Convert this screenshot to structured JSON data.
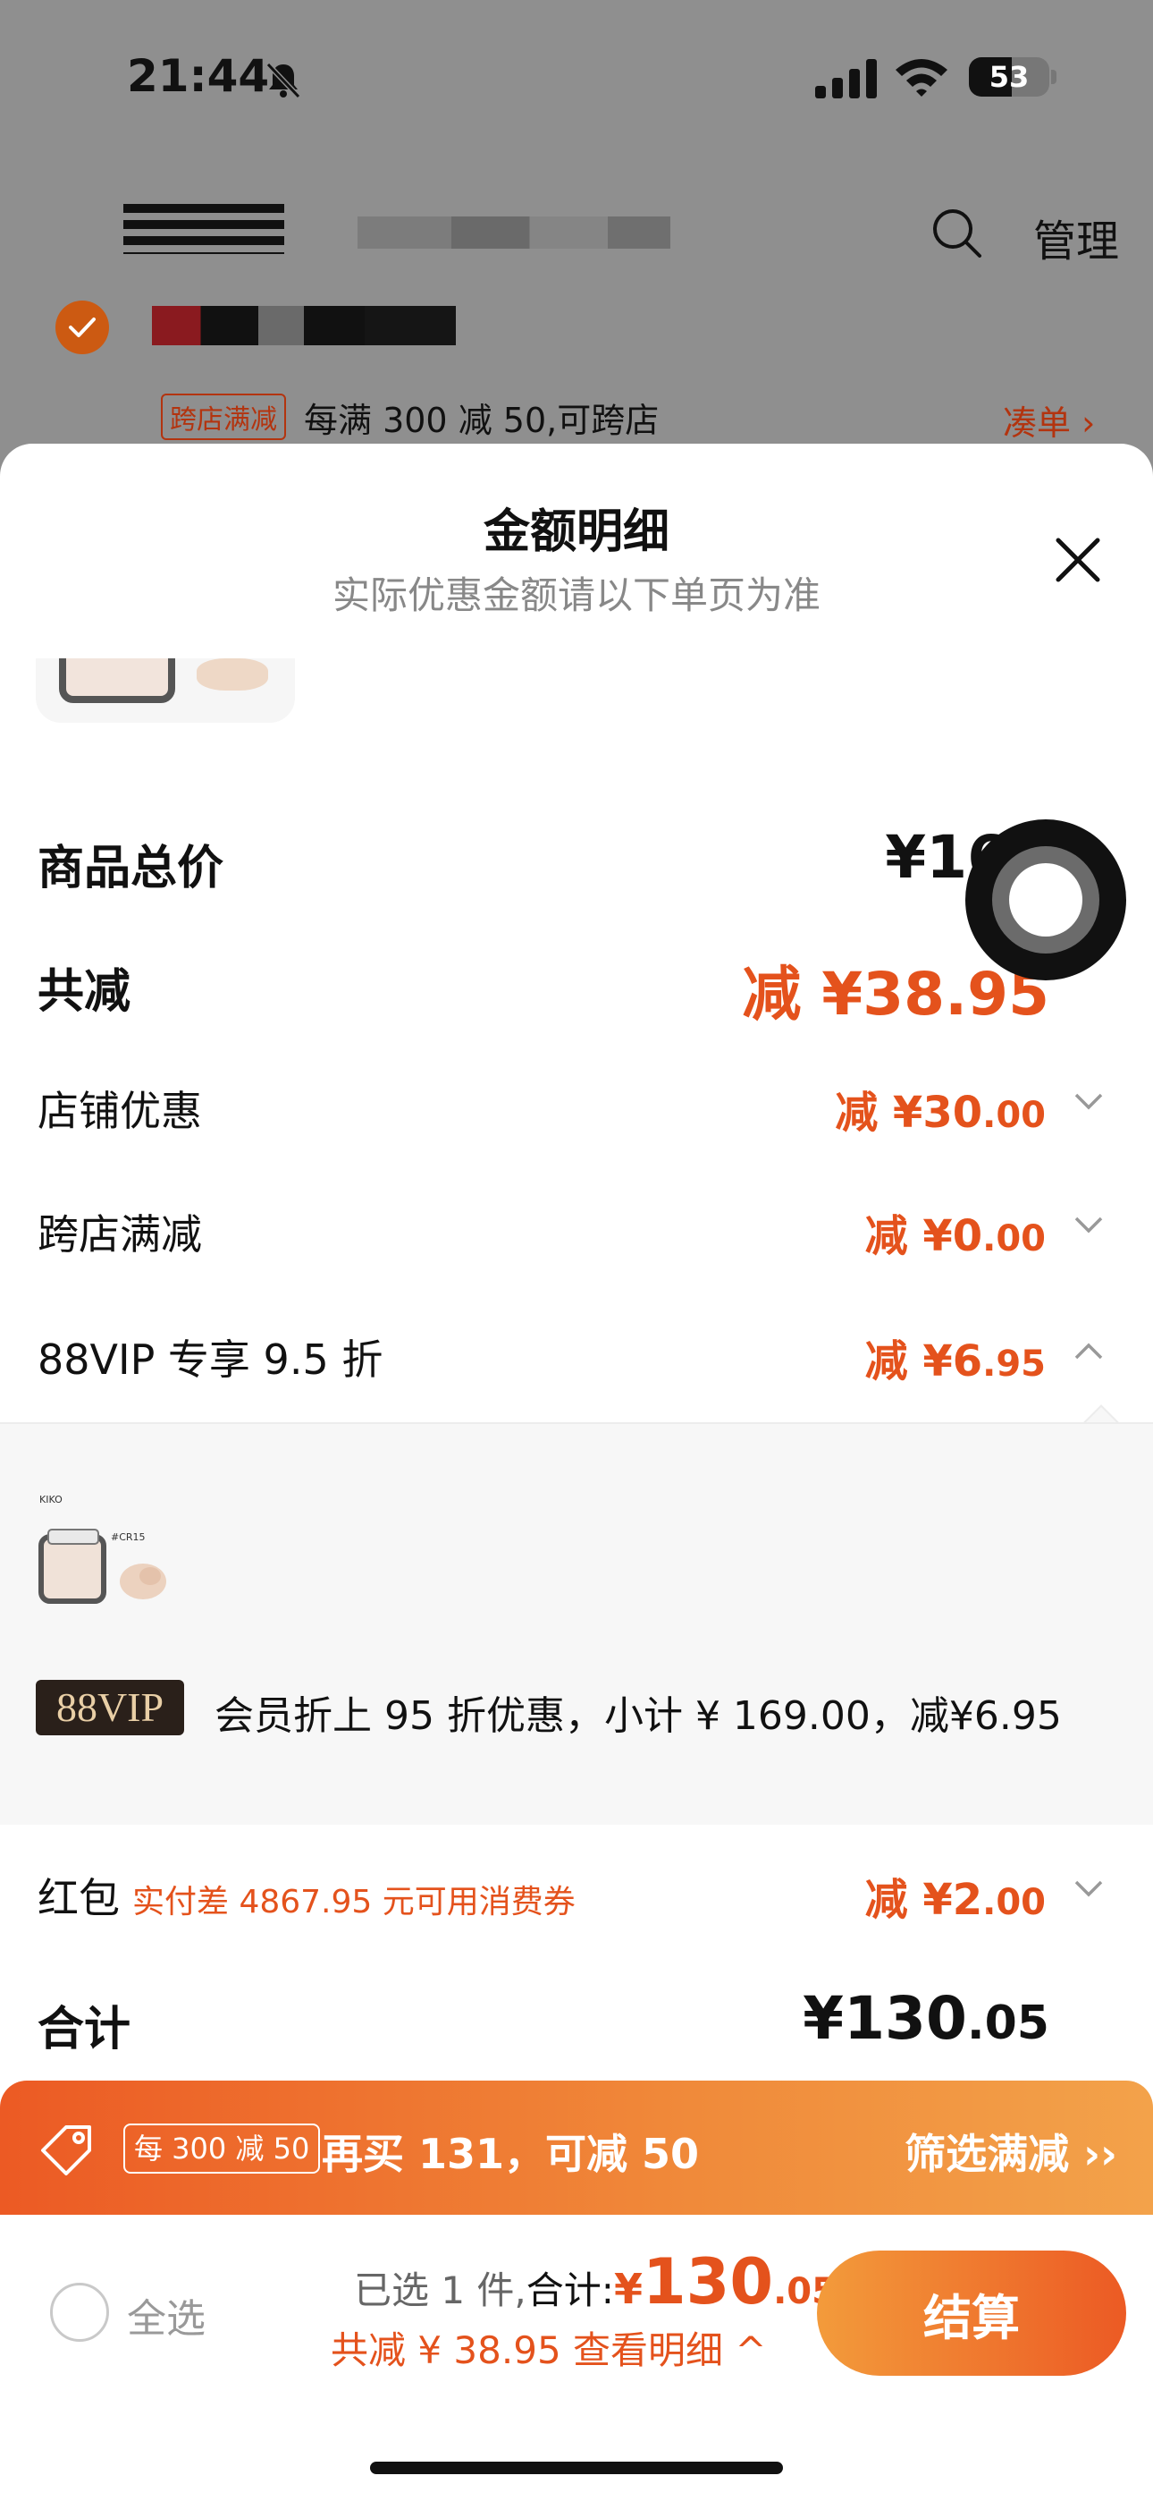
{
  "status_bar": {
    "time": "21:44",
    "battery": "53",
    "battery_level": 0.53
  },
  "cart_header": {
    "manage_label": "管理"
  },
  "promo": {
    "badge": "跨店满减",
    "text": "每满 300 减 50,可跨店",
    "link": "凑单 ›"
  },
  "sheet": {
    "title": "金额明细",
    "subtitle": "实际优惠金额请以下单页为准",
    "rows": {
      "total_price": {
        "label": "商品总价",
        "value": "¥169"
      },
      "total_reduce": {
        "label": "共减",
        "value": "减 ¥38.95"
      },
      "store_discount": {
        "label": "店铺优惠",
        "prefix": "减 ¥30",
        "dec": ".00"
      },
      "cross_store": {
        "label": "跨店满减",
        "prefix": "减 ¥0",
        "dec": ".00"
      },
      "vip": {
        "label": "88VIP 专享 9.5 折",
        "prefix": "减 ¥6",
        "dec": ".95"
      },
      "hongbao": {
        "label": "红包",
        "sub": "实付差 4867.95 元可用消费券",
        "prefix": "减 ¥2",
        "dec": ".00"
      },
      "sum": {
        "label": "合计",
        "prefix": "¥130",
        "dec": ".05"
      }
    },
    "vip_panel": {
      "badge": "88VIP",
      "description": "会员折上 95 折优惠，小计 ¥ 169.00，减¥6.95",
      "product_brand": "KIKO",
      "product_code": "#CR15"
    }
  },
  "banner": {
    "badge": "每 300 减 50",
    "text": "再买 131，可减 50",
    "link": "筛选满减 ››"
  },
  "checkout": {
    "select_all": "全选",
    "count_text": "已选 1 件,",
    "total_label": "合计:",
    "currency": "¥",
    "amount": "130",
    "amount_dec": ".05",
    "detail": "共减 ¥ 38.95  查看明细 ^",
    "button": "结算"
  },
  "colors": {
    "accent": "#e4521c",
    "dim_bg": "#8f8f8f",
    "vip_gold": "#e9cfa6"
  }
}
